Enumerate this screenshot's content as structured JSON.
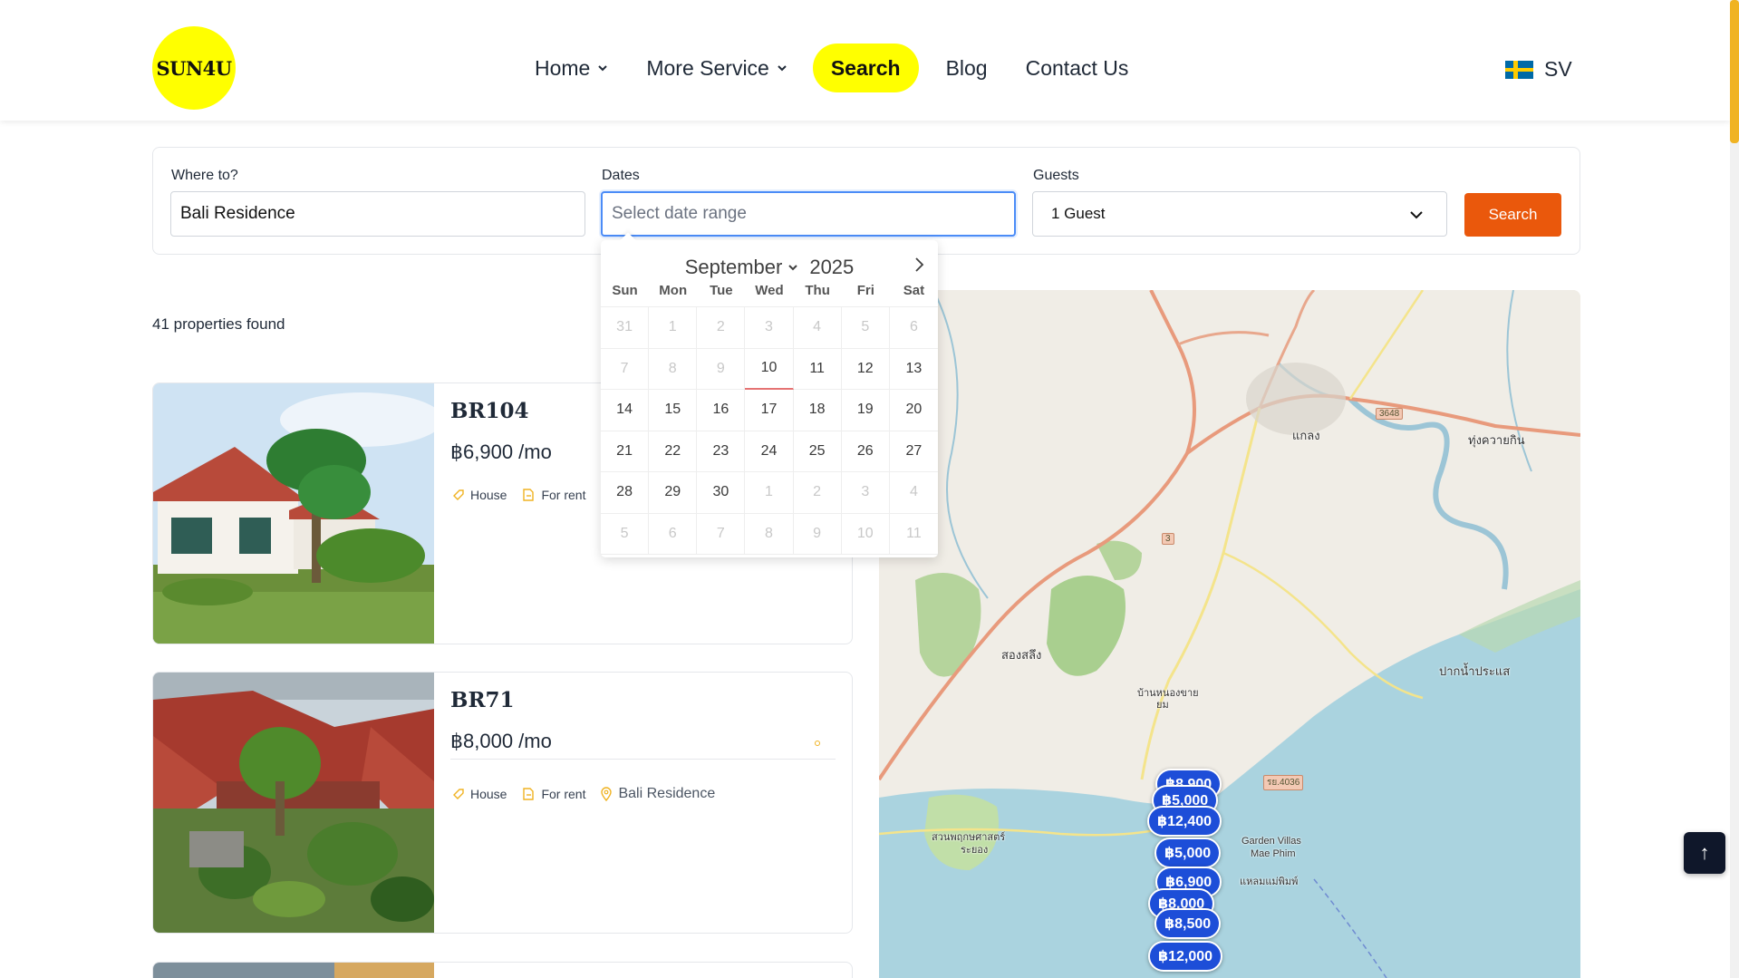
{
  "header": {
    "logo_text": "SUN4U",
    "nav": [
      {
        "label": "Home",
        "dropdown": true
      },
      {
        "label": "More Service",
        "dropdown": true
      },
      {
        "label": "Search",
        "active": true
      },
      {
        "label": "Blog"
      },
      {
        "label": "Contact Us"
      }
    ],
    "language": {
      "code": "SV",
      "flag": "sweden-flag-icon"
    }
  },
  "search": {
    "where_label": "Where to?",
    "where_value": "Bali Residence",
    "dates_label": "Dates",
    "dates_placeholder": "Select date range",
    "guests_label": "Guests",
    "guests_value": "1 Guest",
    "button_label": "Search"
  },
  "calendar": {
    "month": "September",
    "year": "2025",
    "weekdays": [
      "Sun",
      "Mon",
      "Tue",
      "Wed",
      "Thu",
      "Fri",
      "Sat"
    ],
    "days": [
      {
        "d": "31",
        "muted": true
      },
      {
        "d": "1",
        "muted": true
      },
      {
        "d": "2",
        "muted": true
      },
      {
        "d": "3",
        "muted": true
      },
      {
        "d": "4",
        "muted": true
      },
      {
        "d": "5",
        "muted": true
      },
      {
        "d": "6",
        "muted": true
      },
      {
        "d": "7",
        "muted": true
      },
      {
        "d": "8",
        "muted": true
      },
      {
        "d": "9",
        "muted": true
      },
      {
        "d": "10",
        "today": true
      },
      {
        "d": "11"
      },
      {
        "d": "12"
      },
      {
        "d": "13"
      },
      {
        "d": "14"
      },
      {
        "d": "15"
      },
      {
        "d": "16"
      },
      {
        "d": "17"
      },
      {
        "d": "18"
      },
      {
        "d": "19"
      },
      {
        "d": "20"
      },
      {
        "d": "21"
      },
      {
        "d": "22"
      },
      {
        "d": "23"
      },
      {
        "d": "24"
      },
      {
        "d": "25"
      },
      {
        "d": "26"
      },
      {
        "d": "27"
      },
      {
        "d": "28"
      },
      {
        "d": "29"
      },
      {
        "d": "30"
      },
      {
        "d": "1",
        "muted": true
      },
      {
        "d": "2",
        "muted": true
      },
      {
        "d": "3",
        "muted": true
      },
      {
        "d": "4",
        "muted": true
      },
      {
        "d": "5",
        "muted": true
      },
      {
        "d": "6",
        "muted": true
      },
      {
        "d": "7",
        "muted": true
      },
      {
        "d": "8",
        "muted": true
      },
      {
        "d": "9",
        "muted": true
      },
      {
        "d": "10",
        "muted": true
      },
      {
        "d": "11",
        "muted": true
      }
    ]
  },
  "results": {
    "count_text": "41 properties found",
    "properties": [
      {
        "id": "BR104",
        "price": "฿6,900 /mo",
        "type": "House",
        "status": "For rent",
        "location": ""
      },
      {
        "id": "BR71",
        "price": "฿8,000 /mo",
        "type": "House",
        "status": "For rent",
        "location": "Bali Residence"
      }
    ]
  },
  "map": {
    "places": [
      "แกลง",
      "ทุ่งควายกิน",
      "สองสลึง",
      "บ้านหนองขาย",
      "ยม",
      "ปากน้ำประแส",
      "Garden Villas",
      "Mae Phim",
      "แหลมแม่พิมพ์",
      "สวนพฤกษศาสตร์",
      "ระยอง"
    ],
    "road_badges": [
      "3648",
      "3",
      "รย.4036"
    ],
    "price_pins": [
      "฿8,900",
      "฿5,000",
      "฿12,400",
      "฿5,000",
      "฿6,900",
      "฿8,000",
      "฿8,500",
      "฿12,000"
    ]
  },
  "back_to_top": "↑",
  "colors": {
    "brand_yellow": "#ffff00",
    "search_orange": "#ea580c",
    "pin_blue": "#1d4ed8",
    "accent_gold": "#f0b323"
  }
}
